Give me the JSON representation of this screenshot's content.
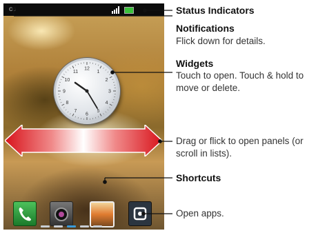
{
  "status_bar": {
    "time": ""
  },
  "callouts": [
    {
      "title": "Status Indicators",
      "desc": ""
    },
    {
      "title": "Notifications",
      "desc": "Flick down for details."
    },
    {
      "title": "Widgets",
      "desc": "Touch to open. Touch & hold to move or delete."
    },
    {
      "title": "",
      "desc": "Drag or flick to open panels (or scroll in lists)."
    },
    {
      "title": "Shortcuts",
      "desc": ""
    },
    {
      "title": "",
      "desc": "Open apps."
    }
  ],
  "clock_numbers": [
    "12",
    "1",
    "2",
    "3",
    "4",
    "5",
    "6",
    "7",
    "8",
    "9",
    "10",
    "11"
  ],
  "dock_apps": [
    "phone-app-icon",
    "camera-app-icon",
    "gallery-app-icon",
    "launcher-app-icon"
  ],
  "colors": {
    "arrow_red": "#e0222a",
    "battery_green": "#3bc23b",
    "callout_line": "#111111"
  }
}
